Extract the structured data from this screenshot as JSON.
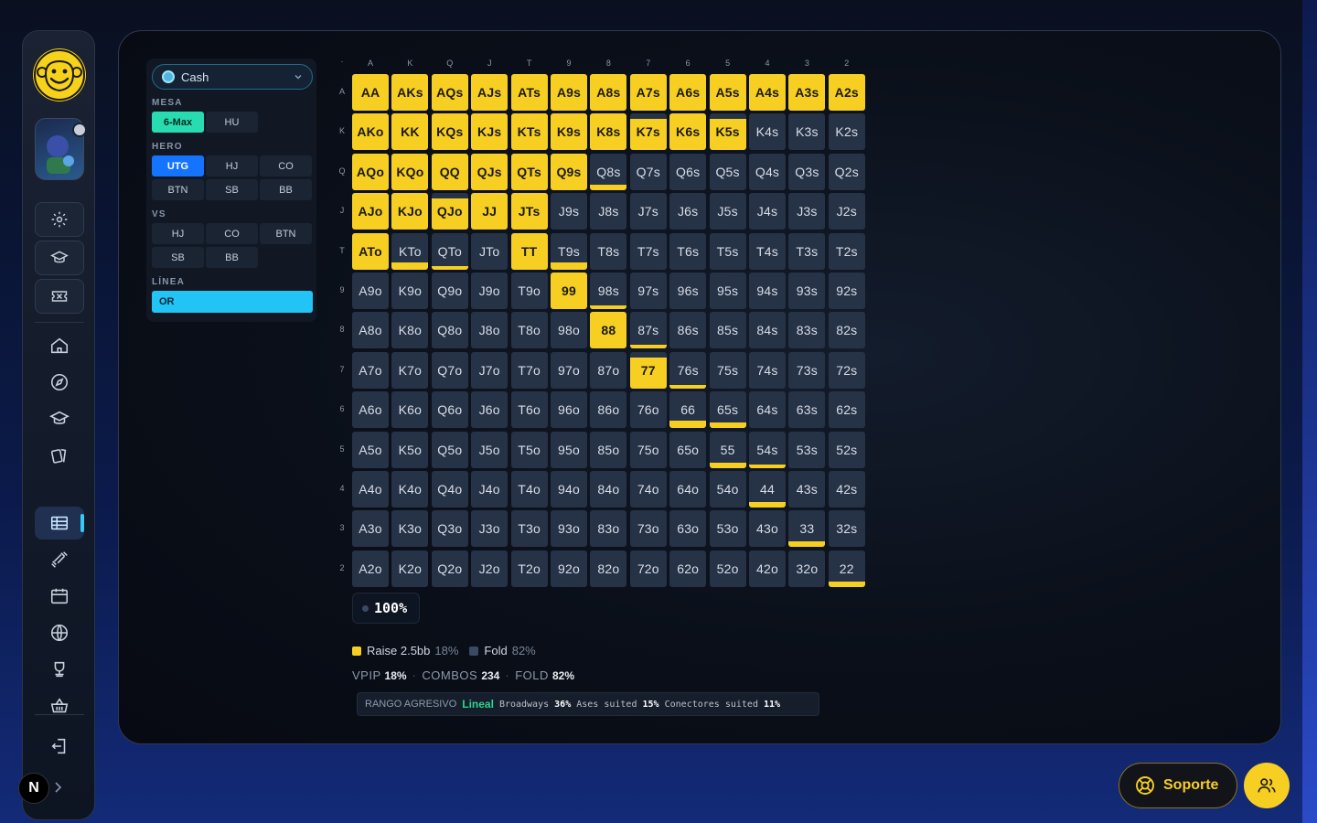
{
  "controls": {
    "game_select": "Cash",
    "mesa": {
      "label": "MESA",
      "options": [
        "6-Max",
        "HU"
      ],
      "selected": "6-Max"
    },
    "hero": {
      "label": "HERO",
      "options": [
        "UTG",
        "HJ",
        "CO",
        "BTN",
        "SB",
        "BB"
      ],
      "selected": "UTG"
    },
    "vs": {
      "label": "VS",
      "options": [
        "HJ",
        "CO",
        "BTN",
        "SB",
        "BB"
      ]
    },
    "linea": {
      "label": "LÍNEA",
      "selected": "OR"
    }
  },
  "grid": {
    "ranks": [
      "A",
      "K",
      "Q",
      "J",
      "T",
      "9",
      "8",
      "7",
      "6",
      "5",
      "4",
      "3",
      "2"
    ],
    "hands": [
      [
        "AA",
        "AKs",
        "AQs",
        "AJs",
        "ATs",
        "A9s",
        "A8s",
        "A7s",
        "A6s",
        "A5s",
        "A4s",
        "A3s",
        "A2s"
      ],
      [
        "AKo",
        "KK",
        "KQs",
        "KJs",
        "KTs",
        "K9s",
        "K8s",
        "K7s",
        "K6s",
        "K5s",
        "K4s",
        "K3s",
        "K2s"
      ],
      [
        "AQo",
        "KQo",
        "QQ",
        "QJs",
        "QTs",
        "Q9s",
        "Q8s",
        "Q7s",
        "Q6s",
        "Q5s",
        "Q4s",
        "Q3s",
        "Q2s"
      ],
      [
        "AJo",
        "KJo",
        "QJo",
        "JJ",
        "JTs",
        "J9s",
        "J8s",
        "J7s",
        "J6s",
        "J5s",
        "J4s",
        "J3s",
        "J2s"
      ],
      [
        "ATo",
        "KTo",
        "QTo",
        "JTo",
        "TT",
        "T9s",
        "T8s",
        "T7s",
        "T6s",
        "T5s",
        "T4s",
        "T3s",
        "T2s"
      ],
      [
        "A9o",
        "K9o",
        "Q9o",
        "J9o",
        "T9o",
        "99",
        "98s",
        "97s",
        "96s",
        "95s",
        "94s",
        "93s",
        "92s"
      ],
      [
        "A8o",
        "K8o",
        "Q8o",
        "J8o",
        "T8o",
        "98o",
        "88",
        "87s",
        "86s",
        "85s",
        "84s",
        "83s",
        "82s"
      ],
      [
        "A7o",
        "K7o",
        "Q7o",
        "J7o",
        "T7o",
        "97o",
        "87o",
        "77",
        "76s",
        "75s",
        "74s",
        "73s",
        "72s"
      ],
      [
        "A6o",
        "K6o",
        "Q6o",
        "J6o",
        "T6o",
        "96o",
        "86o",
        "76o",
        "66",
        "65s",
        "64s",
        "63s",
        "62s"
      ],
      [
        "A5o",
        "K5o",
        "Q5o",
        "J5o",
        "T5o",
        "95o",
        "85o",
        "75o",
        "65o",
        "55",
        "54s",
        "53s",
        "52s"
      ],
      [
        "A4o",
        "K4o",
        "Q4o",
        "J4o",
        "T4o",
        "94o",
        "84o",
        "74o",
        "64o",
        "54o",
        "44",
        "43s",
        "42s"
      ],
      [
        "A3o",
        "K3o",
        "Q3o",
        "J3o",
        "T3o",
        "93o",
        "83o",
        "73o",
        "63o",
        "53o",
        "43o",
        "33",
        "32s"
      ],
      [
        "A2o",
        "K2o",
        "Q2o",
        "J2o",
        "T2o",
        "92o",
        "82o",
        "72o",
        "62o",
        "52o",
        "42o",
        "32o",
        "22"
      ]
    ],
    "raise_freq": {
      "AA": 1,
      "AKs": 1,
      "AQs": 1,
      "AJs": 1,
      "ATs": 1,
      "A9s": 1,
      "A8s": 1,
      "A7s": 1,
      "A6s": 1,
      "A5s": 1,
      "A4s": 1,
      "A3s": 1,
      "A2s": 1,
      "AKo": 1,
      "KK": 1,
      "KQs": 1,
      "KJs": 1,
      "KTs": 1,
      "K9s": 1,
      "K8s": 1,
      "K7s": 0.85,
      "K6s": 1,
      "K5s": 0.85,
      "AQo": 1,
      "KQo": 1,
      "QQ": 1,
      "QJs": 1,
      "QTs": 1,
      "Q9s": 1,
      "Q8s": 0.15,
      "AJo": 1,
      "KJo": 1,
      "QJo": 0.85,
      "JJ": 1,
      "JTs": 1,
      "ATo": 1,
      "KTo": 0.2,
      "QTo": 0.05,
      "TT": 1,
      "T9s": 0.2,
      "99": 1,
      "98s": 0.05,
      "88": 1,
      "87s": 0.05,
      "77": 0.85,
      "76s": 0.1,
      "66": 0.2,
      "65s": 0.15,
      "55": 0.15,
      "54s": 0.08,
      "44": 0.15,
      "33": 0.15,
      "22": 0.15
    }
  },
  "colors": {
    "raise": "#f7cf22",
    "fold": "#263246",
    "accent": "#22c3f5"
  },
  "total_pct": "100%",
  "legend": [
    {
      "label": "Raise 2.5bb",
      "pct": "18%",
      "color": "#f7cf22"
    },
    {
      "label": "Fold",
      "pct": "82%",
      "color": "#3b4a63"
    }
  ],
  "stats": {
    "vpip_label": "VPIP",
    "vpip": "18%",
    "combos_label": "COMBOS",
    "combos": "234",
    "fold_label": "FOLD",
    "fold": "82%"
  },
  "chip": {
    "label": "RANGO AGRESIVO",
    "type": "Lineal",
    "items": [
      {
        "name": "Broadways",
        "pct": "36%"
      },
      {
        "name": "Ases suited",
        "pct": "15%"
      },
      {
        "name": "Conectores suited",
        "pct": "11%"
      }
    ]
  },
  "bottom": {
    "soporte_label": "Soporte"
  },
  "user_badge": "N",
  "icons": [
    "gear-icon",
    "graduation-cap-icon",
    "ticket-icon",
    "home-icon",
    "compass-icon",
    "school-icon",
    "cards-icon",
    "table-icon",
    "dumbbell-icon",
    "calendar-icon",
    "globe-icon",
    "trophy-icon",
    "basket-icon",
    "logout-icon",
    "chevron-right-icon",
    "life-ring-icon",
    "users-icon"
  ]
}
